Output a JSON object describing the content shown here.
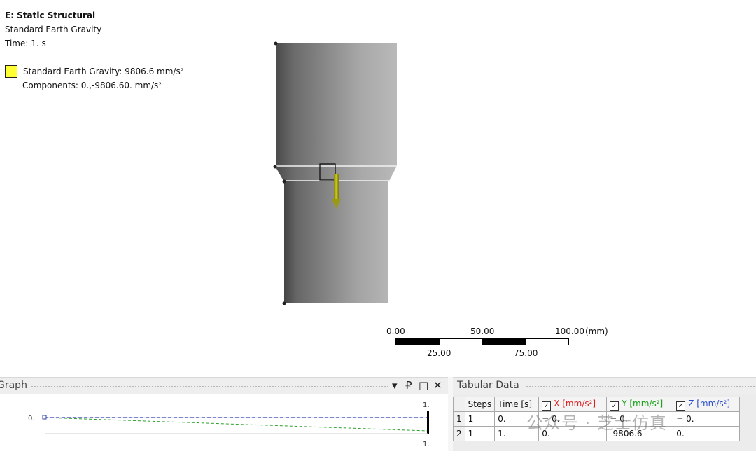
{
  "legend": {
    "title": "E: Static Structural",
    "subtitle": "Standard Earth Gravity",
    "time": "Time: 1. s",
    "item_label": "Standard Earth Gravity: 9806.6 mm/s²",
    "item_components": "Components: 0.,-9806.60. mm/s²",
    "item_color": "#ffff33"
  },
  "scale_bar": {
    "unit": "(mm)",
    "top_labels": [
      "0.00",
      "50.00",
      "100.00"
    ],
    "bottom_labels": [
      "25.00",
      "75.00"
    ]
  },
  "graph_panel": {
    "title": "Graph",
    "controls": [
      "▾",
      "₽",
      "□",
      "✕"
    ],
    "y_label": "0.",
    "x_label_top": "1.",
    "x_label_bottom": "1."
  },
  "tabular_panel": {
    "title": "Tabular Data",
    "headers": [
      "Steps",
      "Time [s]",
      "X [mm/s²]",
      "Y [mm/s²]",
      "Z [mm/s²]"
    ],
    "rows": [
      {
        "num": "1",
        "steps": "1",
        "time": "0.",
        "x": "= 0.",
        "y": "= 0.",
        "z": "= 0."
      },
      {
        "num": "2",
        "steps": "1",
        "time": "1.",
        "x": "0.",
        "y": "-9806.6",
        "z": "0."
      }
    ]
  },
  "watermark": "公众号 · 芝士仿真"
}
